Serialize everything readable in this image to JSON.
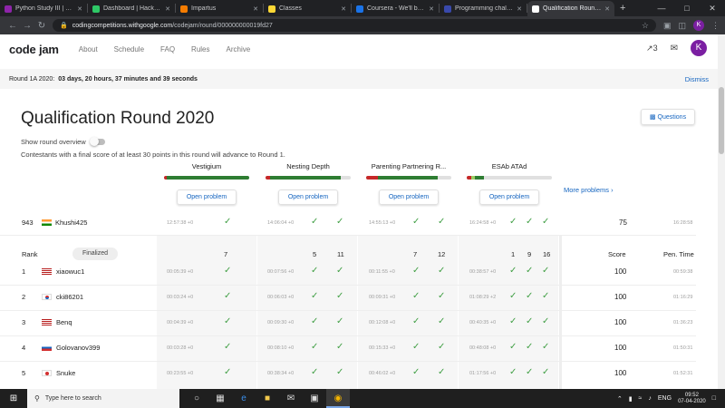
{
  "browser": {
    "tabs": [
      {
        "title": "Python Study III | Progr",
        "color": "#8e24aa"
      },
      {
        "title": "Dashboard | HackerRank",
        "color": "#2ec866"
      },
      {
        "title": "Impartus",
        "color": "#f57c00"
      },
      {
        "title": "Classes",
        "color": "#fdd835"
      },
      {
        "title": "Coursera - We'll be ba",
        "color": "#1a73e8"
      },
      {
        "title": "Programming challeng",
        "color": "#3949ab"
      },
      {
        "title": "Qualification Round 20",
        "color": "#ffffff",
        "active": true
      }
    ],
    "new_tab": "+",
    "url_host": "codingcompetitions.withgoogle.com",
    "url_path": "/codejam/round/000000000019fd27",
    "avatar": "K"
  },
  "site": {
    "logo": "code jam",
    "nav": [
      "About",
      "Schedule",
      "FAQ",
      "Rules",
      "Archive"
    ],
    "notifications": "3",
    "user_initial": "K"
  },
  "banner": {
    "label": "Round 1A 2020:",
    "countdown": "03 days, 20 hours, 37 minutes and 39 seconds",
    "dismiss": "Dismiss"
  },
  "round": {
    "title": "Qualification Round 2020",
    "questions": "Questions",
    "overview": "Show round overview",
    "advance_note": "Contestants with a final score of at least 30 points in this round will advance to Round 1."
  },
  "problems": [
    {
      "name": "Vestigium",
      "open": "Open problem",
      "bar": [
        {
          "c": "#c62828",
          "w": 3
        },
        {
          "c": "#2e7d32",
          "w": 97
        }
      ]
    },
    {
      "name": "Nesting Depth",
      "open": "Open problem",
      "bar": [
        {
          "c": "#c62828",
          "w": 5
        },
        {
          "c": "#2e7d32",
          "w": 83
        }
      ]
    },
    {
      "name": "Parenting Partnering R...",
      "open": "Open problem",
      "bar": [
        {
          "c": "#c62828",
          "w": 14
        },
        {
          "c": "#2e7d32",
          "w": 70
        }
      ]
    },
    {
      "name": "ESAb ATAd",
      "open": "Open problem",
      "bar": [
        {
          "c": "#c62828",
          "w": 5
        },
        {
          "c": "#9ccc65",
          "w": 5
        },
        {
          "c": "#2e7d32",
          "w": 10
        }
      ]
    }
  ],
  "more_problems": "More problems",
  "me": {
    "rank": "943",
    "name": "Khushi425",
    "country": "in",
    "p1": "12:57:38 +0",
    "p2": "14:06:04 +0",
    "p3": "14:55:13 +0",
    "p4": "16:24:58 +0",
    "score": "75",
    "pen": "16:28:58"
  },
  "table_header": {
    "rank": "Rank",
    "finalized": "Finalized",
    "p1_points": [
      "7"
    ],
    "p2_points": [
      "5",
      "11"
    ],
    "p3_points": [
      "7",
      "12"
    ],
    "p4_points": [
      "1",
      "9",
      "16"
    ],
    "score": "Score",
    "pen": "Pen. Time"
  },
  "rows": [
    {
      "rank": "1",
      "name": "xiaowuc1",
      "country": "us",
      "p1": "00:05:39 +0",
      "p2": "00:07:56 +0",
      "p3": "00:11:55 +0",
      "p4": "00:38:57 +0",
      "score": "100",
      "pen": "00:59:38"
    },
    {
      "rank": "2",
      "name": "cki86201",
      "country": "kr",
      "p1": "00:03:24 +0",
      "p2": "00:06:03 +0",
      "p3": "00:09:31 +0",
      "p4": "01:08:29 +2",
      "score": "100",
      "pen": "01:16:29"
    },
    {
      "rank": "3",
      "name": "Benq",
      "country": "us",
      "p1": "00:04:39 +0",
      "p2": "00:09:30 +0",
      "p3": "00:12:08 +0",
      "p4": "00:40:35 +0",
      "score": "100",
      "pen": "01:36:23"
    },
    {
      "rank": "4",
      "name": "Golovanov399",
      "country": "ru",
      "p1": "00:03:28 +0",
      "p2": "00:08:10 +0",
      "p3": "00:15:33 +0",
      "p4": "00:48:08 +0",
      "score": "100",
      "pen": "01:50:31"
    },
    {
      "rank": "5",
      "name": "Snuke",
      "country": "jp",
      "p1": "00:23:55 +0",
      "p2": "00:38:34 +0",
      "p3": "00:46:02 +0",
      "p4": "01:17:56 +0",
      "score": "100",
      "pen": "01:52:31"
    }
  ],
  "taskbar": {
    "search_placeholder": "Type here to search",
    "lang": "ENG",
    "time": "09:52",
    "date": "07-04-2020"
  }
}
